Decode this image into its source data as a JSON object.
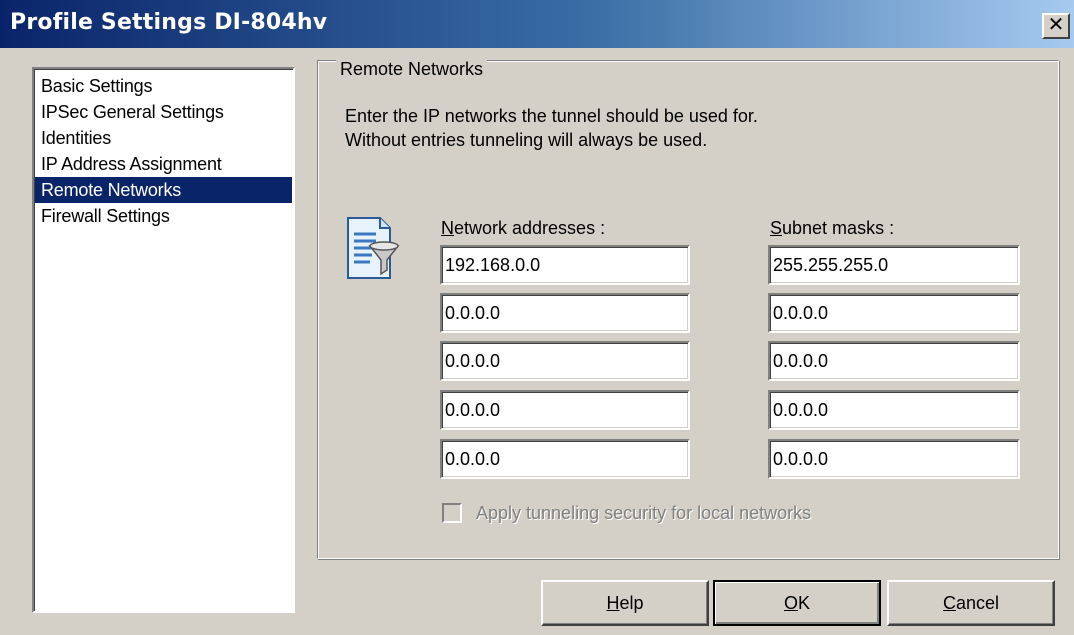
{
  "window": {
    "title": "Profile Settings   DI-804hv",
    "close_glyph": "✕"
  },
  "sidebar": {
    "items": [
      {
        "label": "Basic Settings",
        "selected": false
      },
      {
        "label": "IPSec General Settings",
        "selected": false
      },
      {
        "label": "Identities",
        "selected": false
      },
      {
        "label": "IP Address Assignment",
        "selected": false
      },
      {
        "label": "Remote Networks",
        "selected": true
      },
      {
        "label": "Firewall Settings",
        "selected": false
      }
    ]
  },
  "panel": {
    "group_title": "Remote Networks",
    "description_line1": "Enter the IP networks the tunnel should be used for.",
    "description_line2": "Without entries tunneling will always be used.",
    "network_label_hotkey": "N",
    "network_label_rest": "etwork addresses :",
    "subnet_label_hotkey": "S",
    "subnet_label_rest": "ubnet masks :",
    "network_addresses": [
      "192.168.0.0",
      "0.0.0.0",
      "0.0.0.0",
      "0.0.0.0",
      "0.0.0.0"
    ],
    "subnet_masks": [
      "255.255.255.0",
      "0.0.0.0",
      "0.0.0.0",
      "0.0.0.0",
      "0.0.0.0"
    ],
    "apply_label": "Apply tunneling security for local networks",
    "apply_checked": false,
    "apply_enabled": false
  },
  "buttons": {
    "help_hotkey": "H",
    "help_rest": "elp",
    "ok_hotkey": "O",
    "ok_rest": "K",
    "cancel_hotkey": "C",
    "cancel_rest": "ancel"
  },
  "colors": {
    "selection": "#0a246a",
    "face": "#d4d0c8",
    "title_gradient_start": "#0a246a"
  }
}
